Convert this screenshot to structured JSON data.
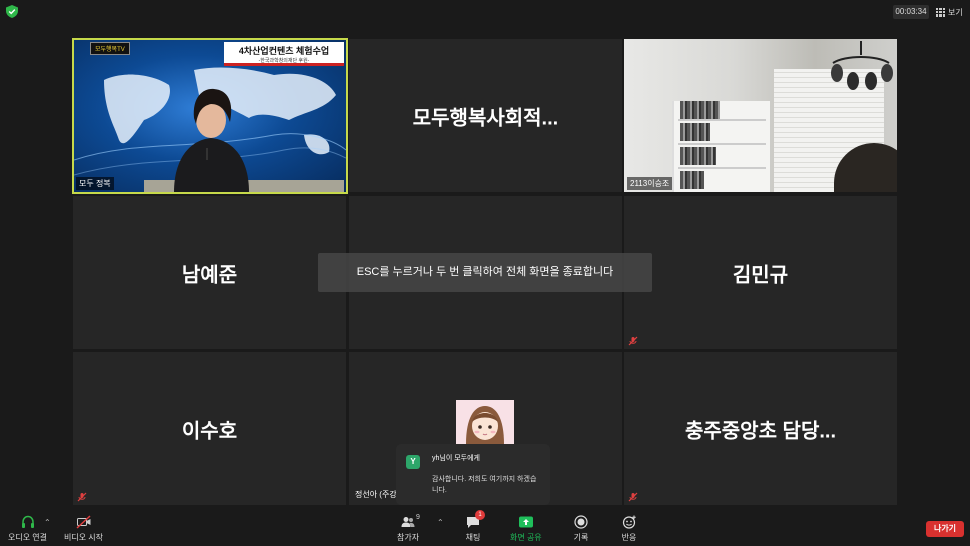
{
  "topbar": {
    "timer": "00:03:34",
    "view_label": "보기"
  },
  "tiles": [
    {
      "id": "host",
      "label": "모두 정복",
      "logo": "모두행복TV",
      "headline": "4차산업컨텐츠 체험수업",
      "subheadline": "-한국과학창의재단 후원-"
    },
    {
      "id": "t2",
      "name": "모두행복사회적..."
    },
    {
      "id": "t3",
      "label": "2113이승조"
    },
    {
      "id": "t4",
      "name": "남예준"
    },
    {
      "id": "t5",
      "name": ""
    },
    {
      "id": "t6",
      "name": "김민규"
    },
    {
      "id": "t7",
      "name": "이수호"
    },
    {
      "id": "t8",
      "label": "정선아 (주강"
    },
    {
      "id": "t9",
      "name": "충주중앙초 담당..."
    }
  ],
  "toast": {
    "text": "ESC를 누르거나 두 번 클릭하여 전체 화면을 종료합니다"
  },
  "chat_popup": {
    "avatar_letter": "Y",
    "from": "yh님이 모두에게",
    "message": "감사합니다. 저희도 여기까지 하겠습니다."
  },
  "toolbar": {
    "audio": "오디오 연결",
    "video": "비디오 시작",
    "participants": "참가자",
    "participants_count": "9",
    "chat": "채팅",
    "chat_badge": "1",
    "share": "화면 공유",
    "record": "기록",
    "reactions": "반응",
    "leave": "나가기"
  },
  "colors": {
    "active_border": "#c6d94a",
    "share_green": "#1fbf5b",
    "leave_red": "#d8312f",
    "tile_bg": "#262626"
  }
}
